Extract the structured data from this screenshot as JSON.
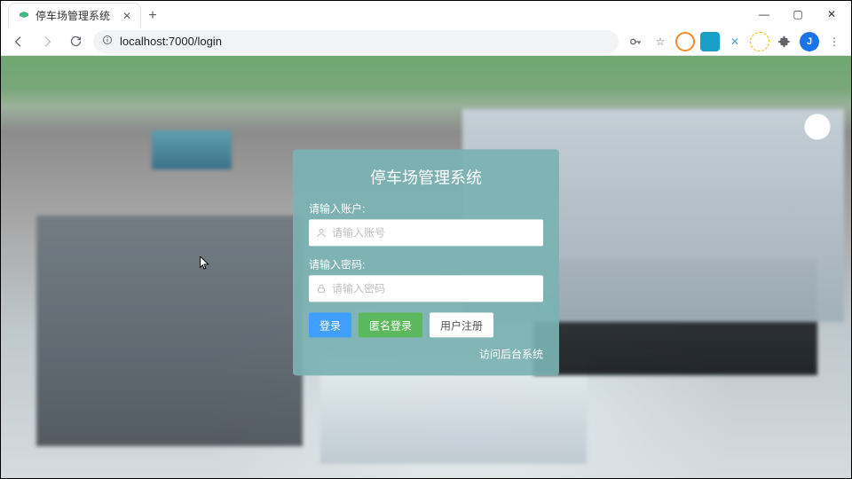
{
  "browser": {
    "tab_title": "停车场管理系统",
    "url": "localhost:7000/login",
    "avatar_letter": "J"
  },
  "login": {
    "title": "停车场管理系统",
    "username_label": "请输入账户:",
    "username_placeholder": "请输入账号",
    "password_label": "请输入密码:",
    "password_placeholder": "请输入密码",
    "login_btn": "登录",
    "anon_btn": "匿名登录",
    "register_btn": "用户注册",
    "backend_link": "访问后台系统"
  }
}
